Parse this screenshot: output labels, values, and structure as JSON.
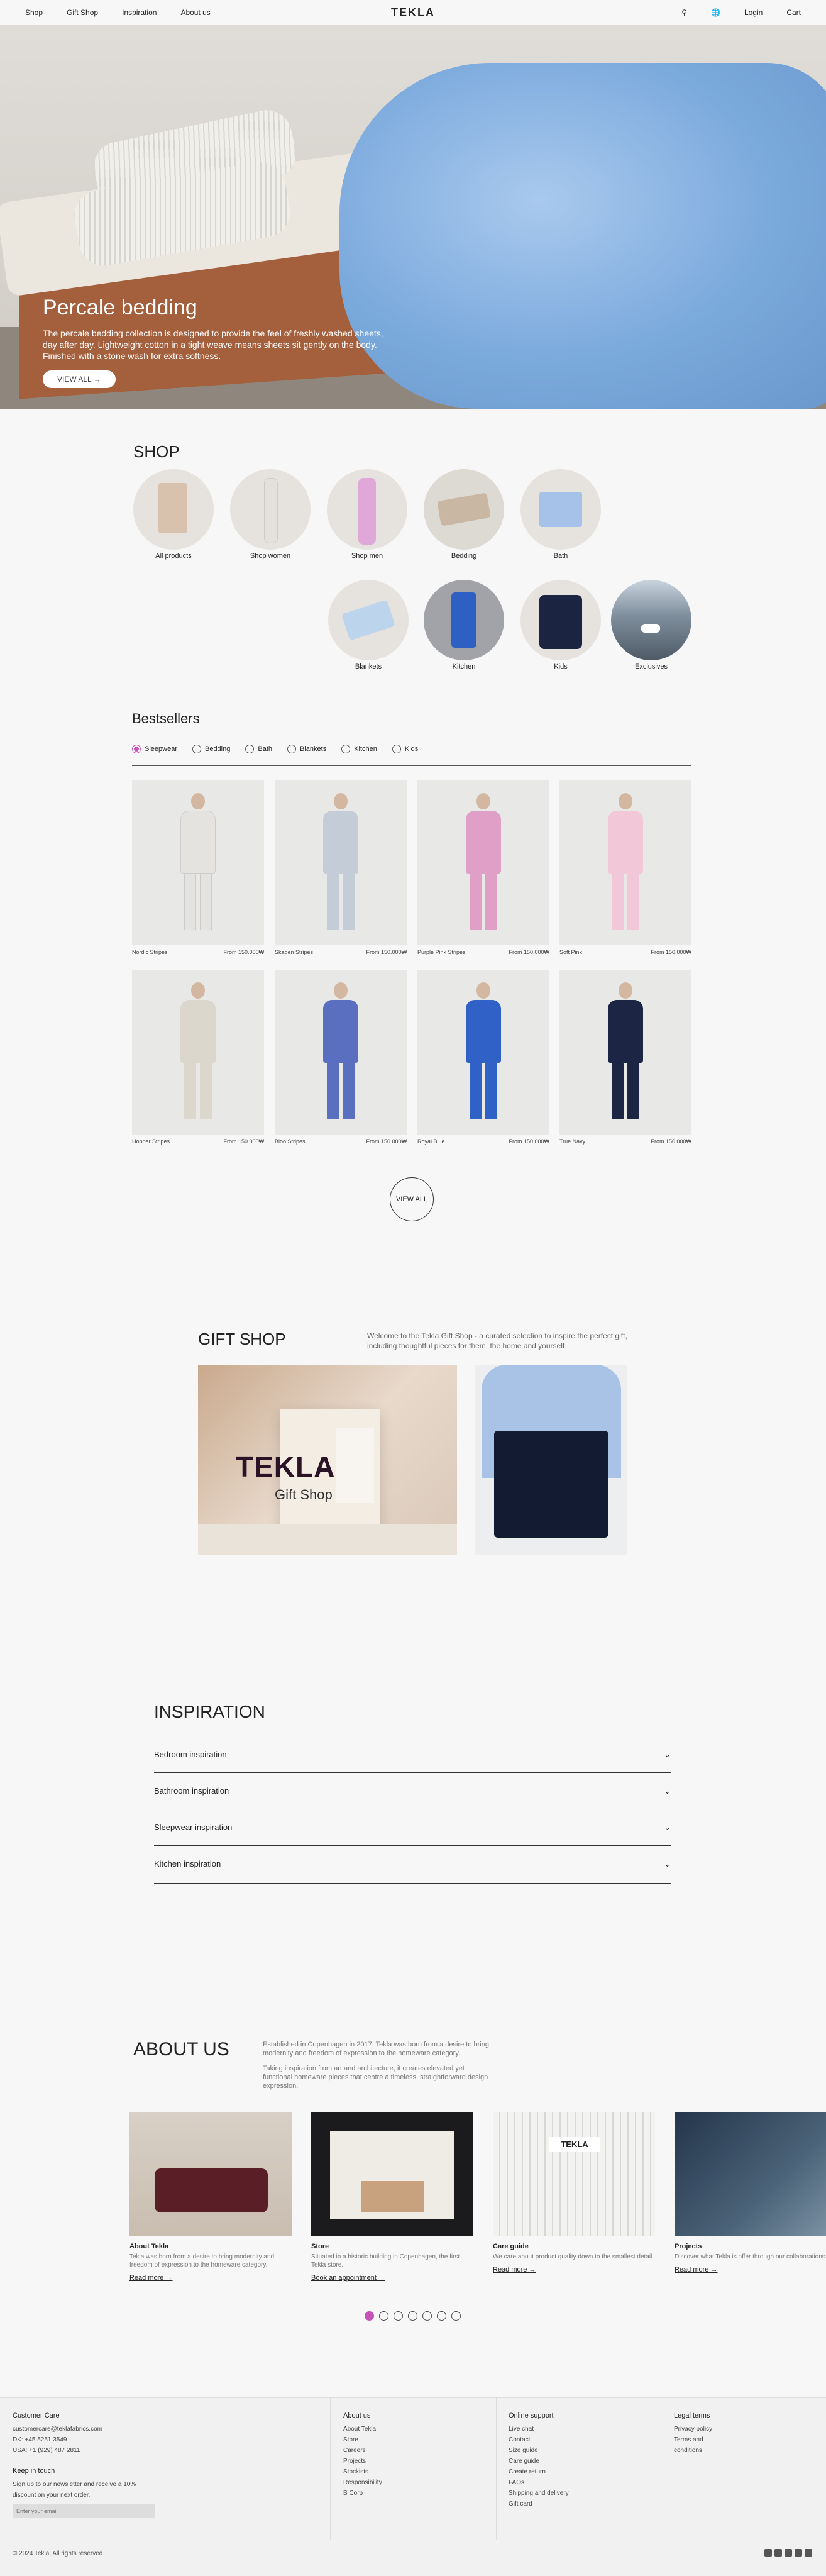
{
  "header": {
    "nav": [
      "Shop",
      "Gift Shop",
      "Inspiration",
      "About us"
    ],
    "logo": "TEKLA",
    "login": "Login",
    "cart": "Cart"
  },
  "hero": {
    "title": "Percale bedding",
    "text": "The percale bedding collection is designed to provide the feel of freshly washed sheets, day after day. Lightweight cotton in a tight weave means sheets sit gently on the body. Finished with a stone wash for extra softness.",
    "button": "VIEW ALL →"
  },
  "shop": {
    "title": "SHOP",
    "categories": [
      "All products",
      "Shop women",
      "Shop men",
      "Bedding",
      "Bath",
      "Blankets",
      "Kitchen",
      "Kids",
      "Exclusives"
    ]
  },
  "bestsellers": {
    "title": "Bestsellers",
    "tabs": [
      "Sleepwear",
      "Bedding",
      "Bath",
      "Blankets",
      "Kitchen",
      "Kids"
    ],
    "products": [
      {
        "name": "Nordic Stripes",
        "price": "From 150.000₩"
      },
      {
        "name": "Skagen Stripes",
        "price": "From 150.000₩"
      },
      {
        "name": "Purple Pink Stripes",
        "price": "From 150.000₩"
      },
      {
        "name": "Soft Pink",
        "price": "From 150.000₩"
      },
      {
        "name": "Hopper Stripes",
        "price": "From 150.000₩"
      },
      {
        "name": "Bloo Stripes",
        "price": "From 150.000₩"
      },
      {
        "name": "Royal Blue",
        "price": "From 150.000₩"
      },
      {
        "name": "True Navy",
        "price": "From 150.000₩"
      }
    ],
    "view_all": "VIEW ALL"
  },
  "gift": {
    "title": "GIFT SHOP",
    "desc": "Welcome to the Tekla Gift Shop - a curated selection to inspire the perfect gift, including thoughtful pieces for them, the home and yourself.",
    "logo_text": "TEKLA",
    "sub_text": "Gift Shop"
  },
  "inspiration": {
    "title": "INSPIRATION",
    "items": [
      "Bedroom inspiration",
      "Bathroom inspiration",
      "Sleepwear inspiration",
      "Kitchen inspiration"
    ]
  },
  "about": {
    "title": "ABOUT US",
    "desc1": "Established in Copenhagen in 2017, Tekla was born from a desire to bring modernity and freedom of expression to the homeware category.",
    "desc2": "Taking inspiration from art and architecture, it creates elevated yet functional homeware pieces that centre a timeless, straightforward design expression.",
    "cards": [
      {
        "title": "About Tekla",
        "text": "Tekla was born from a desire to bring modernity and freedom of expression to the homeware category.",
        "link": "Read more →"
      },
      {
        "title": "Store",
        "text": "Situated in a historic building in Copenhagen, the first Tekla store.",
        "link": "Book an appointment →"
      },
      {
        "title": "Care guide",
        "text": "We care about product quality down to the smallest detail.",
        "link": "Read more →"
      },
      {
        "title": "Projects",
        "text": "Discover what Tekla is offer through our collaborations",
        "link": "Read more →"
      }
    ]
  },
  "footer": {
    "care": {
      "title": "Customer Care",
      "lines": [
        "customercare@teklafabrics.com",
        "DK: +45 5251 3549",
        "USA: +1 (929) 487 2811"
      ]
    },
    "newsletter": {
      "title": "Keep in touch",
      "text": "Sign up to our newsletter and receive a 10% discount on your next order.",
      "placeholder": "Enter your email"
    },
    "about": {
      "title": "About us",
      "links": [
        "About Tekla",
        "Store",
        "Careers",
        "Projects",
        "Stockists",
        "Responsibility",
        "B Corp"
      ]
    },
    "support": {
      "title": "Online support",
      "links": [
        "Live chat",
        "Contact",
        "Size guide",
        "Care guide",
        "Create return",
        "FAQs",
        "Shipping and delivery",
        "Gift card"
      ]
    },
    "legal": {
      "title": "Legal terms",
      "links": [
        "Privacy policy",
        "Terms and conditions"
      ]
    },
    "copyright": "© 2024 Tekla. All rights reserved"
  }
}
